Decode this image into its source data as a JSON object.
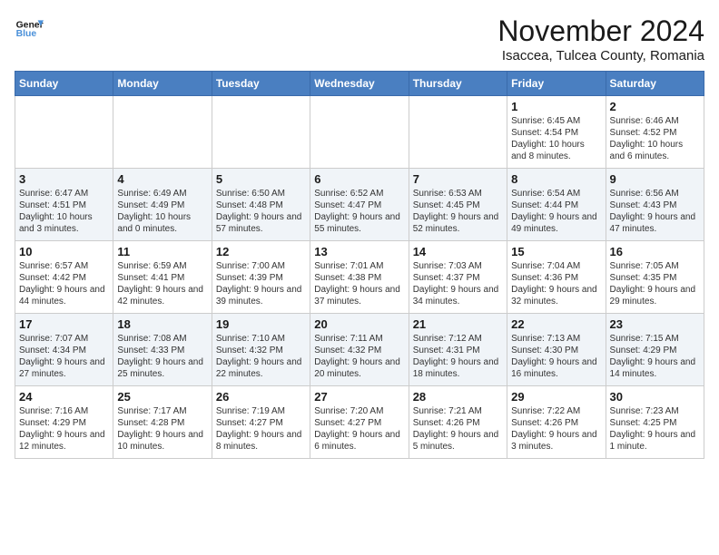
{
  "logo": {
    "line1": "General",
    "line2": "Blue"
  },
  "title": "November 2024",
  "subtitle": "Isaccea, Tulcea County, Romania",
  "days_of_week": [
    "Sunday",
    "Monday",
    "Tuesday",
    "Wednesday",
    "Thursday",
    "Friday",
    "Saturday"
  ],
  "weeks": [
    [
      {
        "day": "",
        "info": ""
      },
      {
        "day": "",
        "info": ""
      },
      {
        "day": "",
        "info": ""
      },
      {
        "day": "",
        "info": ""
      },
      {
        "day": "",
        "info": ""
      },
      {
        "day": "1",
        "info": "Sunrise: 6:45 AM\nSunset: 4:54 PM\nDaylight: 10 hours and 8 minutes."
      },
      {
        "day": "2",
        "info": "Sunrise: 6:46 AM\nSunset: 4:52 PM\nDaylight: 10 hours and 6 minutes."
      }
    ],
    [
      {
        "day": "3",
        "info": "Sunrise: 6:47 AM\nSunset: 4:51 PM\nDaylight: 10 hours and 3 minutes."
      },
      {
        "day": "4",
        "info": "Sunrise: 6:49 AM\nSunset: 4:49 PM\nDaylight: 10 hours and 0 minutes."
      },
      {
        "day": "5",
        "info": "Sunrise: 6:50 AM\nSunset: 4:48 PM\nDaylight: 9 hours and 57 minutes."
      },
      {
        "day": "6",
        "info": "Sunrise: 6:52 AM\nSunset: 4:47 PM\nDaylight: 9 hours and 55 minutes."
      },
      {
        "day": "7",
        "info": "Sunrise: 6:53 AM\nSunset: 4:45 PM\nDaylight: 9 hours and 52 minutes."
      },
      {
        "day": "8",
        "info": "Sunrise: 6:54 AM\nSunset: 4:44 PM\nDaylight: 9 hours and 49 minutes."
      },
      {
        "day": "9",
        "info": "Sunrise: 6:56 AM\nSunset: 4:43 PM\nDaylight: 9 hours and 47 minutes."
      }
    ],
    [
      {
        "day": "10",
        "info": "Sunrise: 6:57 AM\nSunset: 4:42 PM\nDaylight: 9 hours and 44 minutes."
      },
      {
        "day": "11",
        "info": "Sunrise: 6:59 AM\nSunset: 4:41 PM\nDaylight: 9 hours and 42 minutes."
      },
      {
        "day": "12",
        "info": "Sunrise: 7:00 AM\nSunset: 4:39 PM\nDaylight: 9 hours and 39 minutes."
      },
      {
        "day": "13",
        "info": "Sunrise: 7:01 AM\nSunset: 4:38 PM\nDaylight: 9 hours and 37 minutes."
      },
      {
        "day": "14",
        "info": "Sunrise: 7:03 AM\nSunset: 4:37 PM\nDaylight: 9 hours and 34 minutes."
      },
      {
        "day": "15",
        "info": "Sunrise: 7:04 AM\nSunset: 4:36 PM\nDaylight: 9 hours and 32 minutes."
      },
      {
        "day": "16",
        "info": "Sunrise: 7:05 AM\nSunset: 4:35 PM\nDaylight: 9 hours and 29 minutes."
      }
    ],
    [
      {
        "day": "17",
        "info": "Sunrise: 7:07 AM\nSunset: 4:34 PM\nDaylight: 9 hours and 27 minutes."
      },
      {
        "day": "18",
        "info": "Sunrise: 7:08 AM\nSunset: 4:33 PM\nDaylight: 9 hours and 25 minutes."
      },
      {
        "day": "19",
        "info": "Sunrise: 7:10 AM\nSunset: 4:32 PM\nDaylight: 9 hours and 22 minutes."
      },
      {
        "day": "20",
        "info": "Sunrise: 7:11 AM\nSunset: 4:32 PM\nDaylight: 9 hours and 20 minutes."
      },
      {
        "day": "21",
        "info": "Sunrise: 7:12 AM\nSunset: 4:31 PM\nDaylight: 9 hours and 18 minutes."
      },
      {
        "day": "22",
        "info": "Sunrise: 7:13 AM\nSunset: 4:30 PM\nDaylight: 9 hours and 16 minutes."
      },
      {
        "day": "23",
        "info": "Sunrise: 7:15 AM\nSunset: 4:29 PM\nDaylight: 9 hours and 14 minutes."
      }
    ],
    [
      {
        "day": "24",
        "info": "Sunrise: 7:16 AM\nSunset: 4:29 PM\nDaylight: 9 hours and 12 minutes."
      },
      {
        "day": "25",
        "info": "Sunrise: 7:17 AM\nSunset: 4:28 PM\nDaylight: 9 hours and 10 minutes."
      },
      {
        "day": "26",
        "info": "Sunrise: 7:19 AM\nSunset: 4:27 PM\nDaylight: 9 hours and 8 minutes."
      },
      {
        "day": "27",
        "info": "Sunrise: 7:20 AM\nSunset: 4:27 PM\nDaylight: 9 hours and 6 minutes."
      },
      {
        "day": "28",
        "info": "Sunrise: 7:21 AM\nSunset: 4:26 PM\nDaylight: 9 hours and 5 minutes."
      },
      {
        "day": "29",
        "info": "Sunrise: 7:22 AM\nSunset: 4:26 PM\nDaylight: 9 hours and 3 minutes."
      },
      {
        "day": "30",
        "info": "Sunrise: 7:23 AM\nSunset: 4:25 PM\nDaylight: 9 hours and 1 minute."
      }
    ]
  ]
}
